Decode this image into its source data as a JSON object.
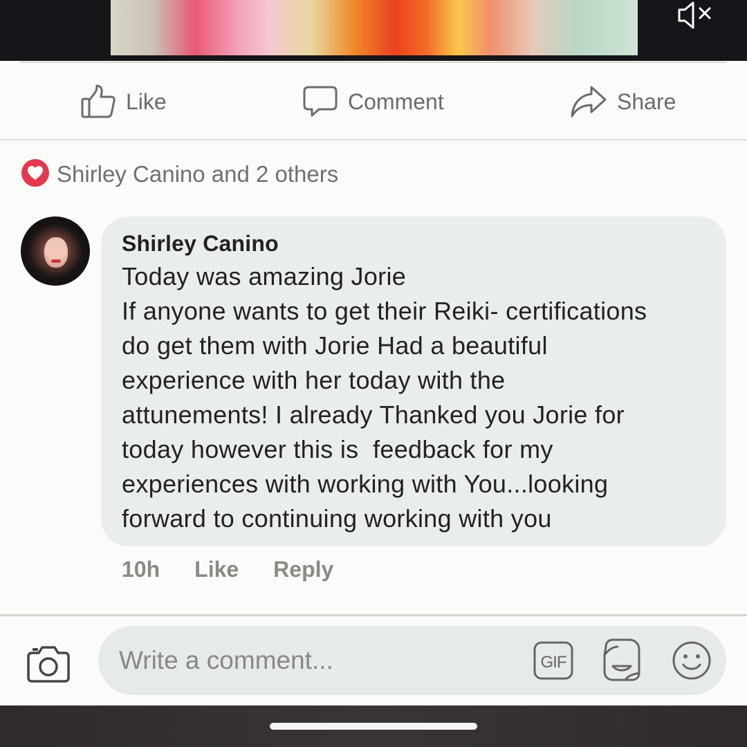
{
  "video": {
    "mute_icon": "volume-muted-icon"
  },
  "actions": [
    {
      "label": "Like",
      "icon": "thumbs-up-icon"
    },
    {
      "label": "Comment",
      "icon": "speech-bubble-icon"
    },
    {
      "label": "Share",
      "icon": "share-arrow-icon"
    }
  ],
  "reactions": {
    "icon": "heart-reaction-icon",
    "icon_color": "#e4384c",
    "summary": "Shirley Canino and 2 others"
  },
  "comment": {
    "author": "Shirley Canino",
    "lines": [
      "Today was amazing Jorie",
      "If anyone wants to get their Reiki- certifications",
      "do get them with Jorie Had a beautiful",
      "experience with her today with the",
      "attunements! I already Thanked you Jorie for",
      "today however this is  feedback for my",
      "experiences with working with You...looking",
      "forward to continuing working with you"
    ],
    "time": "10h",
    "like_label": "Like",
    "reply_label": "Reply"
  },
  "composer": {
    "placeholder": "Write a comment...",
    "camera_icon": "camera-icon",
    "gif_icon": "gif-icon",
    "sticker_icon": "sticker-icon",
    "emoji_icon": "emoji-icon"
  },
  "colors": {
    "background": "#fbfbf9",
    "bubble": "#eaeeea",
    "muted_text": "#6b6b68"
  }
}
